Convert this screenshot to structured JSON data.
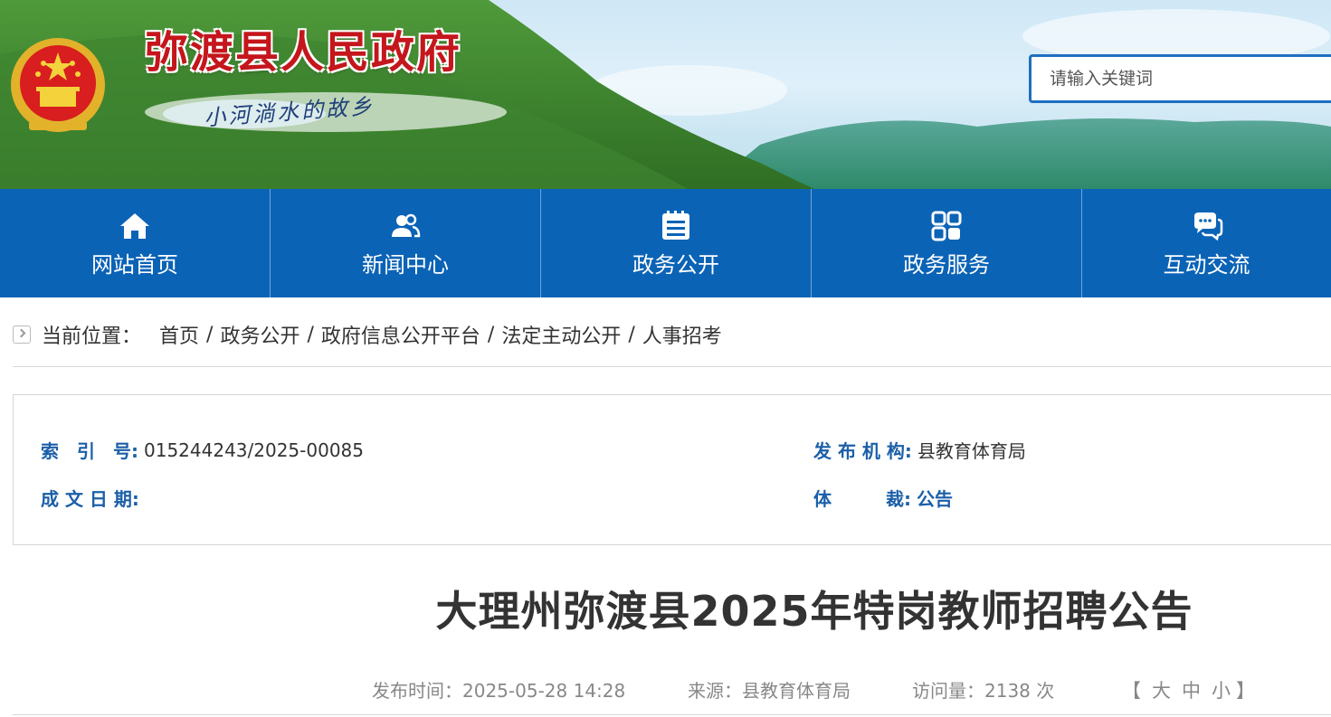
{
  "header": {
    "site_title": "弥渡县人民政府",
    "slogan": "小河淌水的故乡",
    "search": {
      "placeholder": "请输入关键词"
    }
  },
  "nav": {
    "items": [
      {
        "label": "网站首页",
        "icon": "home-icon"
      },
      {
        "label": "新闻中心",
        "icon": "users-icon"
      },
      {
        "label": "政务公开",
        "icon": "document-list-icon"
      },
      {
        "label": "政务服务",
        "icon": "grid-icon"
      },
      {
        "label": "互动交流",
        "icon": "chat-icon"
      }
    ]
  },
  "breadcrumb": {
    "prefix": "当前位置：",
    "items": [
      "首页",
      "政务公开",
      "政府信息公开平台",
      "法定主动公开",
      "人事招考"
    ],
    "separator": "/"
  },
  "info": {
    "index_label": "索　引　号:",
    "index_value": "015244243/2025-00085",
    "publisher_label": "发 布 机 构:",
    "publisher_value": "县教育体育局",
    "date_label": "成 文 日 期:",
    "date_value": "",
    "genre_label": "体　　　裁:",
    "genre_value": "公告"
  },
  "article": {
    "title": "大理州弥渡县2025年特岗教师招聘公告",
    "publish_time_label": "发布时间：",
    "publish_time": "2025-05-28 14:28",
    "source_label": "来源：",
    "source": "县教育体育局",
    "views_label": "访问量：",
    "views": "2138 次",
    "font_size": {
      "open": "【",
      "large": "大",
      "medium": "中",
      "small": "小",
      "close": "】"
    }
  },
  "colors": {
    "nav_bg": "#0b63b6",
    "title_red": "#c4161c",
    "label_blue": "#1b5fa8"
  }
}
